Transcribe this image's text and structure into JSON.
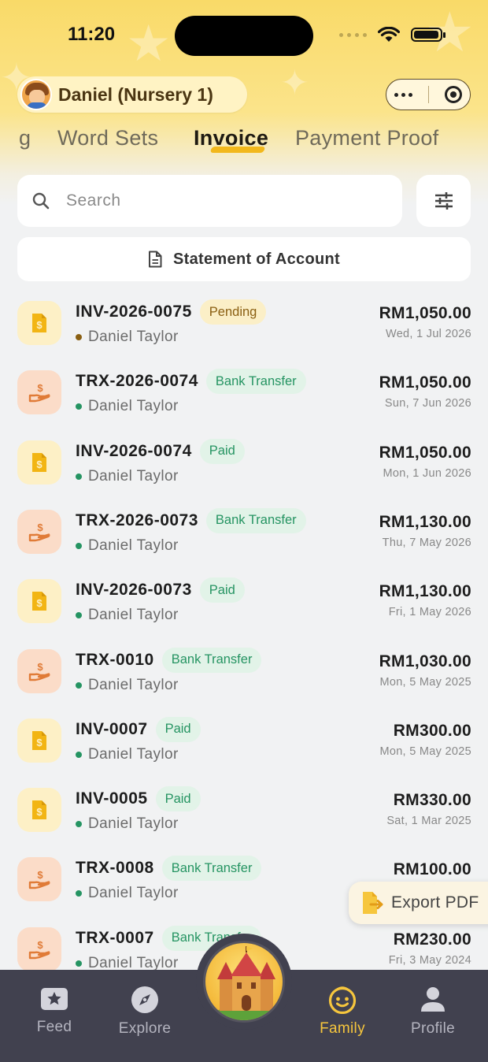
{
  "status_bar": {
    "time": "11:20"
  },
  "header": {
    "child_name": "Daniel (Nursery 1)"
  },
  "tabs": [
    {
      "label": "g"
    },
    {
      "label": "Word Sets"
    },
    {
      "label": "Invoice"
    },
    {
      "label": "Payment Proof"
    }
  ],
  "search": {
    "placeholder": "Search"
  },
  "statement_button": {
    "label": "Statement of Account"
  },
  "transactions": [
    {
      "id": "INV-2026-0075",
      "kind": "invoice",
      "status": "Pending",
      "student": "Daniel Taylor",
      "amount": "RM1,050.00",
      "date": "Wed, 1 Jul 2026"
    },
    {
      "id": "TRX-2026-0074",
      "kind": "transfer",
      "status": "Bank Transfer",
      "student": "Daniel Taylor",
      "amount": "RM1,050.00",
      "date": "Sun, 7 Jun 2026"
    },
    {
      "id": "INV-2026-0074",
      "kind": "invoice",
      "status": "Paid",
      "student": "Daniel Taylor",
      "amount": "RM1,050.00",
      "date": "Mon, 1 Jun 2026"
    },
    {
      "id": "TRX-2026-0073",
      "kind": "transfer",
      "status": "Bank Transfer",
      "student": "Daniel Taylor",
      "amount": "RM1,130.00",
      "date": "Thu, 7 May 2026"
    },
    {
      "id": "INV-2026-0073",
      "kind": "invoice",
      "status": "Paid",
      "student": "Daniel Taylor",
      "amount": "RM1,130.00",
      "date": "Fri, 1 May 2026"
    },
    {
      "id": "TRX-0010",
      "kind": "transfer",
      "status": "Bank Transfer",
      "student": "Daniel Taylor",
      "amount": "RM1,030.00",
      "date": "Mon, 5 May 2025"
    },
    {
      "id": "INV-0007",
      "kind": "invoice",
      "status": "Paid",
      "student": "Daniel Taylor",
      "amount": "RM300.00",
      "date": "Mon, 5 May 2025"
    },
    {
      "id": "INV-0005",
      "kind": "invoice",
      "status": "Paid",
      "student": "Daniel Taylor",
      "amount": "RM330.00",
      "date": "Sat, 1 Mar 2025"
    },
    {
      "id": "TRX-0008",
      "kind": "transfer",
      "status": "Bank Transfer",
      "student": "Daniel Taylor",
      "amount": "RM100.00",
      "date": ""
    },
    {
      "id": "TRX-0007",
      "kind": "transfer",
      "status": "Bank Transfer",
      "student": "Daniel Taylor",
      "amount": "RM230.00",
      "date": "Fri, 3 May 2024"
    }
  ],
  "export_button": {
    "label": "Export PDF"
  },
  "bottom_nav": [
    {
      "label": "Feed",
      "icon": "star-card-icon"
    },
    {
      "label": "Explore",
      "icon": "compass-icon"
    },
    {
      "label": "Family",
      "icon": "smiley-face-icon",
      "active": true
    },
    {
      "label": "Profile",
      "icon": "person-icon"
    }
  ],
  "colors": {
    "accent_yellow": "#f6c63d",
    "pending_text": "#8a5f12",
    "paid_green": "#259462",
    "nav_bg": "#41414f"
  }
}
